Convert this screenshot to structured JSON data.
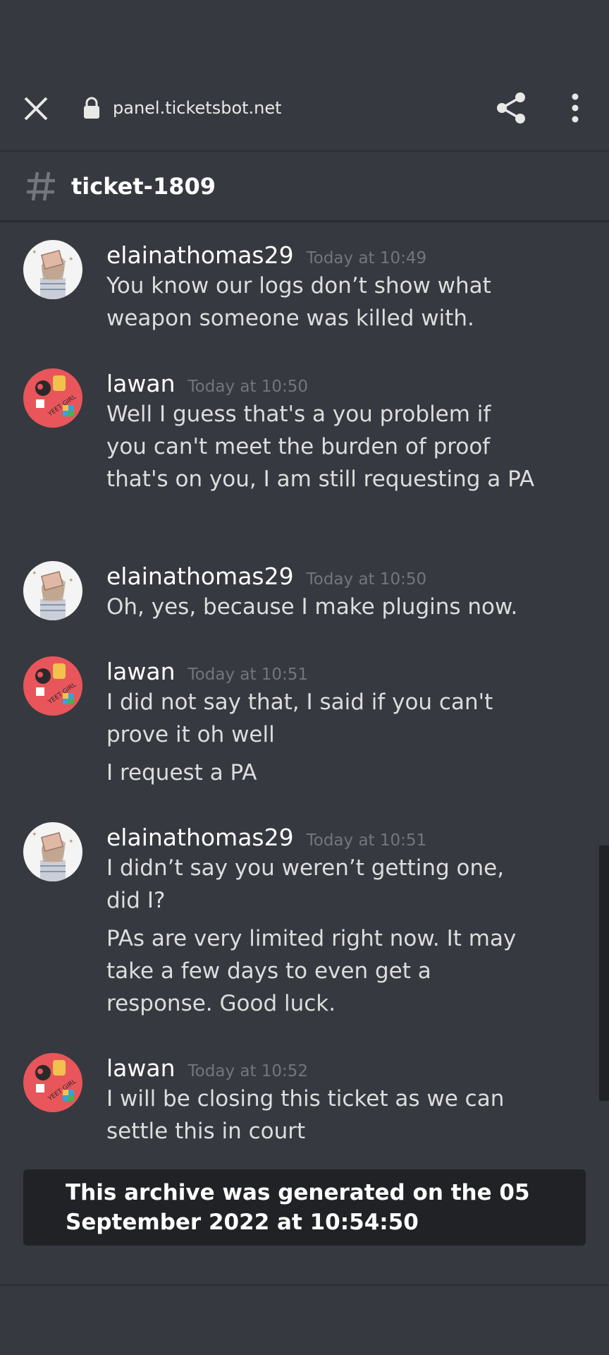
{
  "browser": {
    "url": "panel.ticketsbot.net"
  },
  "channel": {
    "name": "ticket-1809"
  },
  "messages": [
    {
      "author": "elainathomas29",
      "timestamp": "Today at 10:49",
      "avatar": "girl-sketch-avatar",
      "lines": [
        "You know our logs don’t show what weapon someone was killed with."
      ]
    },
    {
      "author": "lawan",
      "timestamp": "Today at 10:50",
      "avatar": "yeet-girl-avatar",
      "lines": [
        "Well I guess that's a you problem if you can't meet the burden of proof that's on you, I am still requesting a PA"
      ]
    },
    {
      "author": "elainathomas29",
      "timestamp": "Today at 10:50",
      "avatar": "girl-sketch-avatar",
      "lines": [
        "Oh, yes, because I make plugins now."
      ]
    },
    {
      "author": "lawan",
      "timestamp": "Today at 10:51",
      "avatar": "yeet-girl-avatar",
      "lines": [
        "I did not say that, I said if you can't prove it oh well",
        "I request a PA"
      ]
    },
    {
      "author": "elainathomas29",
      "timestamp": "Today at 10:51",
      "avatar": "girl-sketch-avatar",
      "lines": [
        "I didn’t say you weren’t getting one, did I?",
        "PAs are very limited right now. It may take a few days to even get a response. Good luck."
      ]
    },
    {
      "author": "lawan",
      "timestamp": "Today at 10:52",
      "avatar": "yeet-girl-avatar",
      "lines": [
        "I will be closing this ticket as we can settle this in court"
      ]
    }
  ],
  "archive_notice": "This archive was generated on the 05 September 2022 at 10:54:50",
  "avatar_logo_text": "YEET GIRL",
  "colors": {
    "background": "#36393f",
    "archive_bg": "#202225",
    "timestamp": "#72767d",
    "avatar_red": "#e8555a"
  }
}
